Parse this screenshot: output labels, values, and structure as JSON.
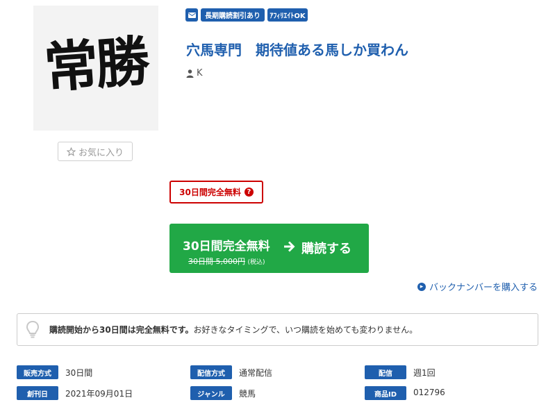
{
  "logo": {
    "text": "常勝"
  },
  "favorite": {
    "icon": "star-outline-icon",
    "label": "お気に入り"
  },
  "badges": {
    "mail_icon": "envelope-icon",
    "long_term": "長期購読割引あり",
    "affiliate": "ｱﾌｨﾘｴｲﾄOK"
  },
  "title": "穴馬専門　期待値ある馬しか買わん",
  "author": {
    "icon": "user-icon",
    "name": "K"
  },
  "trial_badge": {
    "label": "30日間完全無料",
    "icon": "question-circle-icon"
  },
  "subscribe": {
    "free_label": "30日間完全無料",
    "old_price": "30日間 5,000円",
    "tax": "(税込)",
    "action": "購読する",
    "arrow_icon": "arrow-right-icon"
  },
  "backnumber": {
    "icon": "arrow-circle-right-icon",
    "label": "バックナンバーを購入する"
  },
  "notice": {
    "icon": "lightbulb-icon",
    "bold": "購読開始から30日間は完全無料です。",
    "rest": "お好きなタイミングで、いつ購読を始めても変わりません。"
  },
  "details": [
    {
      "label": "販売方式",
      "value": "30日間"
    },
    {
      "label": "配信方式",
      "value": "通常配信"
    },
    {
      "label": "配信",
      "value": "週1回"
    },
    {
      "label": "創刊日",
      "value": "2021年09月01日"
    },
    {
      "label": "ジャンル",
      "value": "競馬"
    },
    {
      "label": "商品ID",
      "value": "012796"
    }
  ],
  "colors": {
    "brand": "#1f5fae",
    "success": "#21a846",
    "danger": "#cc0000"
  }
}
